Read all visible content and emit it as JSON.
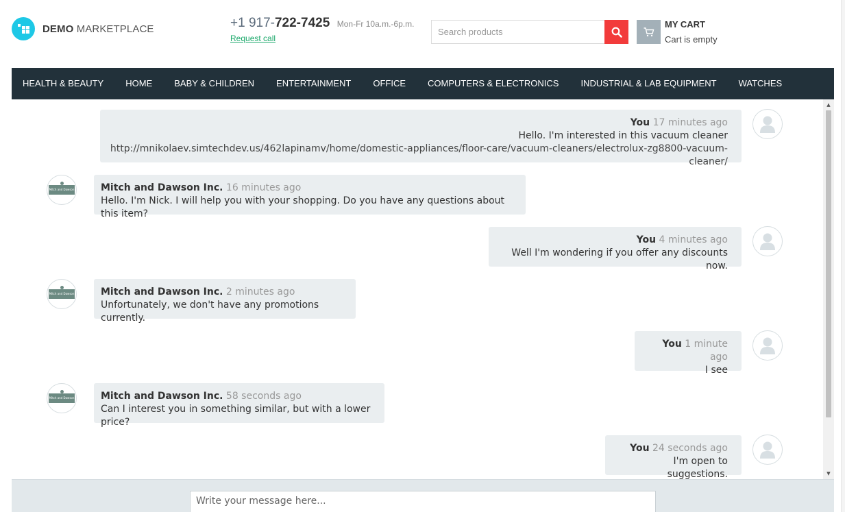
{
  "header": {
    "logo_bold": "DEMO",
    "logo_light": "MARKETPLACE",
    "phone_prefix": "+1 917-",
    "phone_main": "722-7425",
    "hours": "Mon-Fr 10a.m.-6p.m.",
    "request_call": "Request call",
    "search_placeholder": "Search products",
    "cart_title": "MY CART",
    "cart_status": "Cart is empty"
  },
  "nav": {
    "items": [
      {
        "label": "HEALTH & BEAUTY"
      },
      {
        "label": "HOME"
      },
      {
        "label": "BABY & CHILDREN"
      },
      {
        "label": "ENTERTAINMENT"
      },
      {
        "label": "OFFICE"
      },
      {
        "label": "COMPUTERS & ELECTRONICS"
      },
      {
        "label": "INDUSTRIAL & LAB EQUIPMENT"
      },
      {
        "label": "WATCHES"
      }
    ]
  },
  "chat": {
    "vendor_logo_text": "Mitch and Dawson",
    "messages": [
      {
        "author": "You",
        "time": "17 minutes ago",
        "text": "Hello. I'm interested in this vacuum cleaner",
        "link": "http://mnikolaev.simtechdev.us/462lapinamv/home/domestic-appliances/floor-care/vacuum-cleaners/electrolux-zg8800-vacuum-cleaner/"
      },
      {
        "author": "Mitch and Dawson Inc.",
        "time": "16 minutes ago",
        "text": "Hello. I'm Nick. I will help you with your shopping. Do you have any questions about this item?"
      },
      {
        "author": "You",
        "time": "4 minutes ago",
        "text": "Well I'm wondering if you offer any discounts now."
      },
      {
        "author": "Mitch and Dawson Inc.",
        "time": "2 minutes ago",
        "text": "Unfortunately, we don't have any promotions currently."
      },
      {
        "author": "You",
        "time": "1 minute ago",
        "text": "I see"
      },
      {
        "author": "Mitch and Dawson Inc.",
        "time": "58 seconds ago",
        "text": "Can I interest you in something similar, but with a lower price?"
      },
      {
        "author": "You",
        "time": "24 seconds ago",
        "text": "I'm open to suggestions."
      }
    ]
  },
  "composer": {
    "placeholder": "Write your message here..."
  },
  "colors": {
    "nav_bg": "#22313a",
    "search_button": "#f23b3b",
    "cart_icon_bg": "#a3b0b8",
    "logo_accent": "#1ec8e6",
    "request_call_link": "#1aa86a",
    "bubble_bg": "#eaeef0"
  },
  "icons": {
    "logo": "grid-logo-icon",
    "search": "search-icon",
    "cart": "cart-icon",
    "user_avatar": "user-silhouette-icon",
    "vendor_avatar": "vendor-logo-icon"
  }
}
